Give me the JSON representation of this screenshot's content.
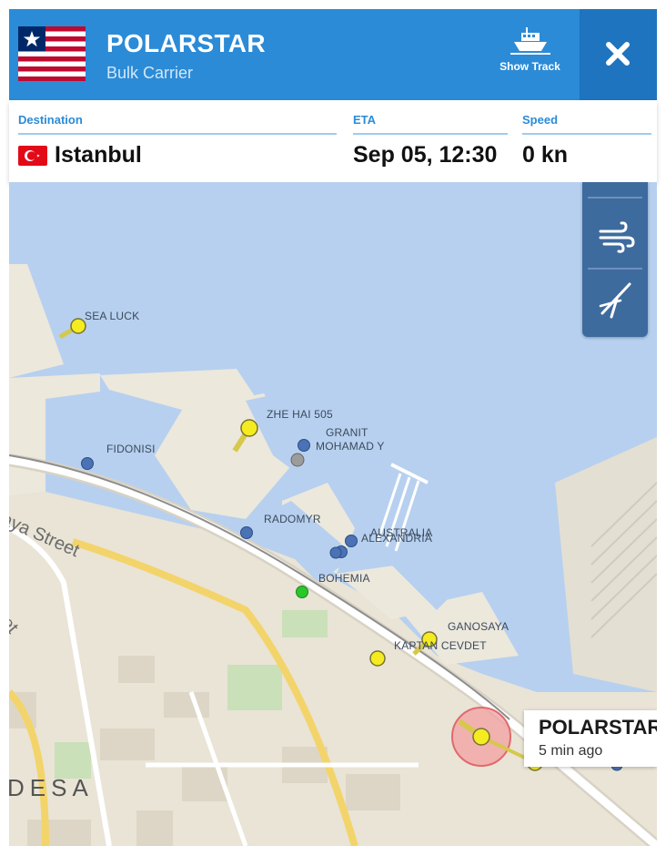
{
  "vessel": {
    "name": "POLARSTAR",
    "type": "Bulk Carrier",
    "flag_icon": "liberia-flag-icon"
  },
  "header": {
    "show_track_label": "Show Track",
    "close_icon": "close-icon",
    "accent_color": "#2b8bd7",
    "close_bg_color": "#1e74bf"
  },
  "info": {
    "destination_label": "Destination",
    "destination_value": "Istanbul",
    "destination_flag_icon": "turkey-flag-icon",
    "eta_label": "ETA",
    "eta_value": "Sep 05, 12:30",
    "speed_label": "Speed",
    "speed_value": "0 kn"
  },
  "map": {
    "ships": [
      {
        "name": "SEA LUCK",
        "color": "yellow"
      },
      {
        "name": "ZHE HAI 505",
        "color": "yellow"
      },
      {
        "name": "GRANIT",
        "color": "blue"
      },
      {
        "name": "MOHAMAD Y",
        "color": "gray"
      },
      {
        "name": "FIDONISI",
        "color": "blue"
      },
      {
        "name": "RADOMYR",
        "color": "blue"
      },
      {
        "name": "AUSTRALIA",
        "color": "blue"
      },
      {
        "name": "ALEXANDRIA",
        "color": "blue"
      },
      {
        "name": "BOHEMIA",
        "color": "green"
      },
      {
        "name": "GANOSAYA",
        "color": "yellow"
      },
      {
        "name": "KAPTAN CEVDET",
        "color": "yellow"
      }
    ],
    "streets": [
      "kaya Street",
      "Street"
    ],
    "city_label": "DESA",
    "controls": [
      "wind-icon",
      "compass-icon"
    ],
    "selected": {
      "name": "POLARSTAR",
      "time_ago": "5 min ago"
    }
  }
}
